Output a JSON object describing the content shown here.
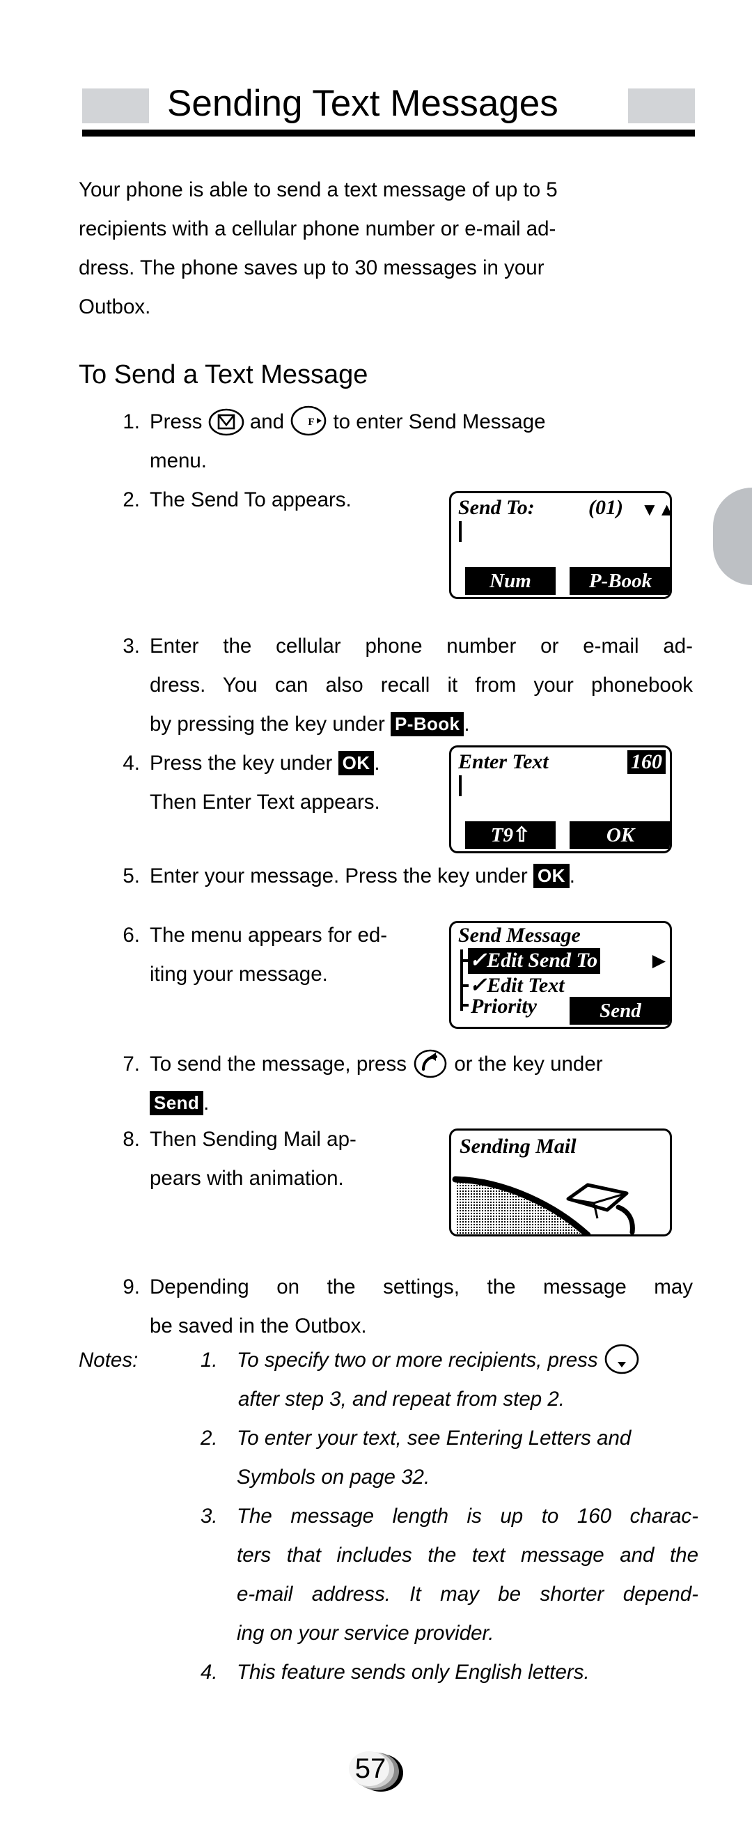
{
  "header": {
    "title": "Sending Text Messages"
  },
  "intro": {
    "lines": [
      "Your phone is able to send a text message of up to 5",
      "recipients with a cellular phone number or e-mail ad-",
      "dress. The phone saves up to 30 messages in your",
      "Outbox."
    ]
  },
  "section": {
    "heading": "To Send a Text Message"
  },
  "steps": [
    {
      "num": "1.",
      "pre": "Press",
      "mid": "and",
      "post": "to enter  Send Message",
      "line2": "menu.",
      "icon1": "envelope-key-icon",
      "icon2": "function-key-icon"
    },
    {
      "num": "2.",
      "text": "The  Send To  appears."
    },
    {
      "num": "3.",
      "line1": "Enter the cellular phone number or e-mail ad-",
      "line2": "dress. You can also recall it from your phonebook",
      "line3_pre": "by pressing the key under",
      "line3_chip": "P-Book",
      "line3_post": "."
    },
    {
      "num": "4.",
      "line1_pre": "Press the key under",
      "line1_chip": "OK",
      "line1_post": ".",
      "line2": "Then  Enter Text  appears."
    },
    {
      "num": "5.",
      "pre": "Enter your message. Press the key under",
      "chip": "OK",
      "post": "."
    },
    {
      "num": "6.",
      "line1": "The menu appears for ed-",
      "line2": "iting your message."
    },
    {
      "num": "7.",
      "pre": "To send the message, press",
      "mid": "or the key under",
      "chip": "Send",
      "post": ".",
      "icon": "send-call-key-icon"
    },
    {
      "num": "8.",
      "line1": "Then  Sending Mail    ap-",
      "line2": "pears with animation."
    },
    {
      "num": "9.",
      "line1": "Depending on the settings, the message may",
      "line2": "be saved in the Outbox."
    }
  ],
  "screens": {
    "send_to": {
      "title": "Send To:",
      "counter": "(01)",
      "arrows": "▼▲",
      "softkey_left": "Num",
      "softkey_right": "P-Book"
    },
    "enter_text": {
      "title": "Enter Text",
      "counter": "160",
      "softkey_left": "T9",
      "softkey_left_icon": "shift-up-arrow-icon",
      "softkey_right": "OK"
    },
    "send_message_menu": {
      "title": "Send Message",
      "items": [
        {
          "check": "✓",
          "label": "Edit Send To",
          "selected": true,
          "submenu_arrow": "▶"
        },
        {
          "check": "✓",
          "label": "Edit Text",
          "selected": false
        },
        {
          "check": "",
          "label": "Priority",
          "selected": false
        }
      ],
      "softkey_right": "Send"
    },
    "sending_mail": {
      "title": "Sending Mail",
      "graphic": "envelope-flying-animation"
    }
  },
  "notes": {
    "label": "Notes:",
    "items": [
      {
        "num": "1.",
        "line1_pre": "To specify two or more recipients, press",
        "icon": "down-navigation-key-icon",
        "line2": "after step 3, and repeat from step 2."
      },
      {
        "num": "2.",
        "line1": "To enter your text, see Entering Letters and",
        "line2": "Symbols  on page 32."
      },
      {
        "num": "3.",
        "line1": "The message length is up to 160 charac-",
        "line2": "ters that includes the text message and the",
        "line3": "e-mail address. It may be shorter depend-",
        "line4": "ing on your service provider."
      },
      {
        "num": "4.",
        "line1": "This feature sends only English letters."
      }
    ]
  },
  "footer": {
    "page_number": "57"
  },
  "colors": {
    "header_block": "#d2d4d7",
    "edge_tab": "#bdc0c4",
    "ink": "#000000"
  }
}
